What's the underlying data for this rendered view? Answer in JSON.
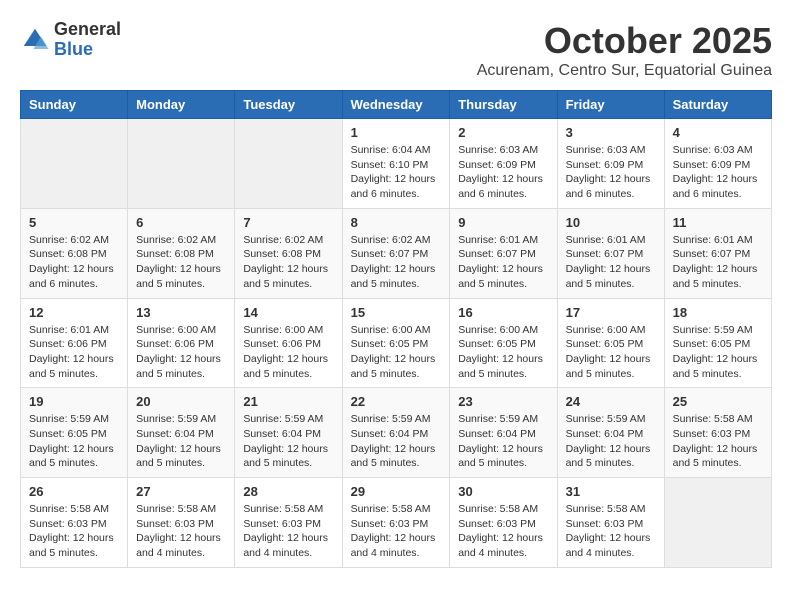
{
  "header": {
    "logo_line1": "General",
    "logo_line2": "Blue",
    "month": "October 2025",
    "location": "Acurenam, Centro Sur, Equatorial Guinea"
  },
  "days_of_week": [
    "Sunday",
    "Monday",
    "Tuesday",
    "Wednesday",
    "Thursday",
    "Friday",
    "Saturday"
  ],
  "weeks": [
    [
      {
        "day": "",
        "info": ""
      },
      {
        "day": "",
        "info": ""
      },
      {
        "day": "",
        "info": ""
      },
      {
        "day": "1",
        "info": "Sunrise: 6:04 AM\nSunset: 6:10 PM\nDaylight: 12 hours and 6 minutes."
      },
      {
        "day": "2",
        "info": "Sunrise: 6:03 AM\nSunset: 6:09 PM\nDaylight: 12 hours and 6 minutes."
      },
      {
        "day": "3",
        "info": "Sunrise: 6:03 AM\nSunset: 6:09 PM\nDaylight: 12 hours and 6 minutes."
      },
      {
        "day": "4",
        "info": "Sunrise: 6:03 AM\nSunset: 6:09 PM\nDaylight: 12 hours and 6 minutes."
      }
    ],
    [
      {
        "day": "5",
        "info": "Sunrise: 6:02 AM\nSunset: 6:08 PM\nDaylight: 12 hours and 6 minutes."
      },
      {
        "day": "6",
        "info": "Sunrise: 6:02 AM\nSunset: 6:08 PM\nDaylight: 12 hours and 5 minutes."
      },
      {
        "day": "7",
        "info": "Sunrise: 6:02 AM\nSunset: 6:08 PM\nDaylight: 12 hours and 5 minutes."
      },
      {
        "day": "8",
        "info": "Sunrise: 6:02 AM\nSunset: 6:07 PM\nDaylight: 12 hours and 5 minutes."
      },
      {
        "day": "9",
        "info": "Sunrise: 6:01 AM\nSunset: 6:07 PM\nDaylight: 12 hours and 5 minutes."
      },
      {
        "day": "10",
        "info": "Sunrise: 6:01 AM\nSunset: 6:07 PM\nDaylight: 12 hours and 5 minutes."
      },
      {
        "day": "11",
        "info": "Sunrise: 6:01 AM\nSunset: 6:07 PM\nDaylight: 12 hours and 5 minutes."
      }
    ],
    [
      {
        "day": "12",
        "info": "Sunrise: 6:01 AM\nSunset: 6:06 PM\nDaylight: 12 hours and 5 minutes."
      },
      {
        "day": "13",
        "info": "Sunrise: 6:00 AM\nSunset: 6:06 PM\nDaylight: 12 hours and 5 minutes."
      },
      {
        "day": "14",
        "info": "Sunrise: 6:00 AM\nSunset: 6:06 PM\nDaylight: 12 hours and 5 minutes."
      },
      {
        "day": "15",
        "info": "Sunrise: 6:00 AM\nSunset: 6:05 PM\nDaylight: 12 hours and 5 minutes."
      },
      {
        "day": "16",
        "info": "Sunrise: 6:00 AM\nSunset: 6:05 PM\nDaylight: 12 hours and 5 minutes."
      },
      {
        "day": "17",
        "info": "Sunrise: 6:00 AM\nSunset: 6:05 PM\nDaylight: 12 hours and 5 minutes."
      },
      {
        "day": "18",
        "info": "Sunrise: 5:59 AM\nSunset: 6:05 PM\nDaylight: 12 hours and 5 minutes."
      }
    ],
    [
      {
        "day": "19",
        "info": "Sunrise: 5:59 AM\nSunset: 6:05 PM\nDaylight: 12 hours and 5 minutes."
      },
      {
        "day": "20",
        "info": "Sunrise: 5:59 AM\nSunset: 6:04 PM\nDaylight: 12 hours and 5 minutes."
      },
      {
        "day": "21",
        "info": "Sunrise: 5:59 AM\nSunset: 6:04 PM\nDaylight: 12 hours and 5 minutes."
      },
      {
        "day": "22",
        "info": "Sunrise: 5:59 AM\nSunset: 6:04 PM\nDaylight: 12 hours and 5 minutes."
      },
      {
        "day": "23",
        "info": "Sunrise: 5:59 AM\nSunset: 6:04 PM\nDaylight: 12 hours and 5 minutes."
      },
      {
        "day": "24",
        "info": "Sunrise: 5:59 AM\nSunset: 6:04 PM\nDaylight: 12 hours and 5 minutes."
      },
      {
        "day": "25",
        "info": "Sunrise: 5:58 AM\nSunset: 6:03 PM\nDaylight: 12 hours and 5 minutes."
      }
    ],
    [
      {
        "day": "26",
        "info": "Sunrise: 5:58 AM\nSunset: 6:03 PM\nDaylight: 12 hours and 5 minutes."
      },
      {
        "day": "27",
        "info": "Sunrise: 5:58 AM\nSunset: 6:03 PM\nDaylight: 12 hours and 4 minutes."
      },
      {
        "day": "28",
        "info": "Sunrise: 5:58 AM\nSunset: 6:03 PM\nDaylight: 12 hours and 4 minutes."
      },
      {
        "day": "29",
        "info": "Sunrise: 5:58 AM\nSunset: 6:03 PM\nDaylight: 12 hours and 4 minutes."
      },
      {
        "day": "30",
        "info": "Sunrise: 5:58 AM\nSunset: 6:03 PM\nDaylight: 12 hours and 4 minutes."
      },
      {
        "day": "31",
        "info": "Sunrise: 5:58 AM\nSunset: 6:03 PM\nDaylight: 12 hours and 4 minutes."
      },
      {
        "day": "",
        "info": ""
      }
    ]
  ]
}
